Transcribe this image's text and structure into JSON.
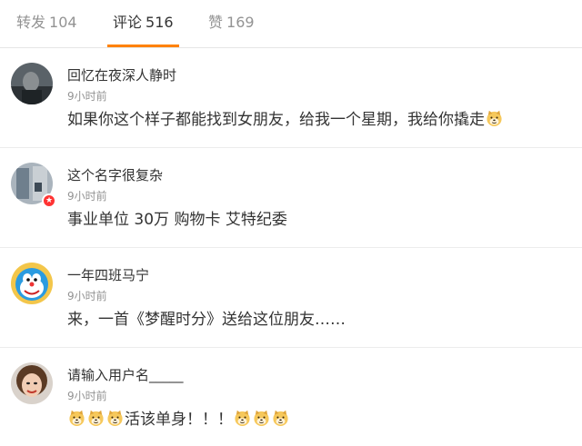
{
  "tabs": [
    {
      "label": "转发",
      "count": "104",
      "active": false
    },
    {
      "label": "评论",
      "count": "516",
      "active": true
    },
    {
      "label": "赞",
      "count": "169",
      "active": false
    }
  ],
  "comments": [
    {
      "user": "回忆在夜深人静时",
      "time": "9小时前",
      "text": "如果你这个样子都能找到女朋友，给我一个星期，我给你撬走"
    },
    {
      "user": "这个名字很复杂",
      "time": "9小时前",
      "text": "事业单位 30万 购物卡 艾特纪委"
    },
    {
      "user": "一年四班马宁",
      "time": "9小时前",
      "text": "来，一首《梦醒时分》送给这位朋友……"
    },
    {
      "user": "请输入用户名_____",
      "time": "9小时前",
      "text": "活该单身！！！"
    }
  ],
  "colors": {
    "accent": "#ff8200",
    "muted": "#939393",
    "badge": "#ff3333"
  },
  "icons": {
    "emoji": "doge-emoji-icon",
    "badge": "verified-badge-icon"
  }
}
